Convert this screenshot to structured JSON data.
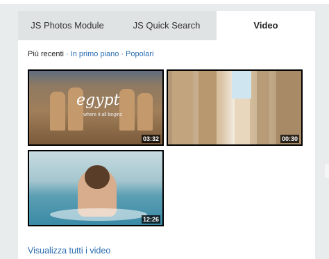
{
  "tabs": [
    {
      "label": "JS Photos Module"
    },
    {
      "label": "JS Quick Search"
    },
    {
      "label": "Video"
    }
  ],
  "filters": {
    "label": "Più recenti",
    "sep1": "·",
    "link1": "In primo piano",
    "sep2": "·",
    "link2": "Popolari"
  },
  "videos": [
    {
      "title_overlay": "egypt",
      "tagline": "where it all begins",
      "duration": "03:32"
    },
    {
      "duration": "00:30"
    },
    {
      "duration": "12:26"
    }
  ],
  "footer": {
    "view_all": "Visualizza tutti i video"
  }
}
